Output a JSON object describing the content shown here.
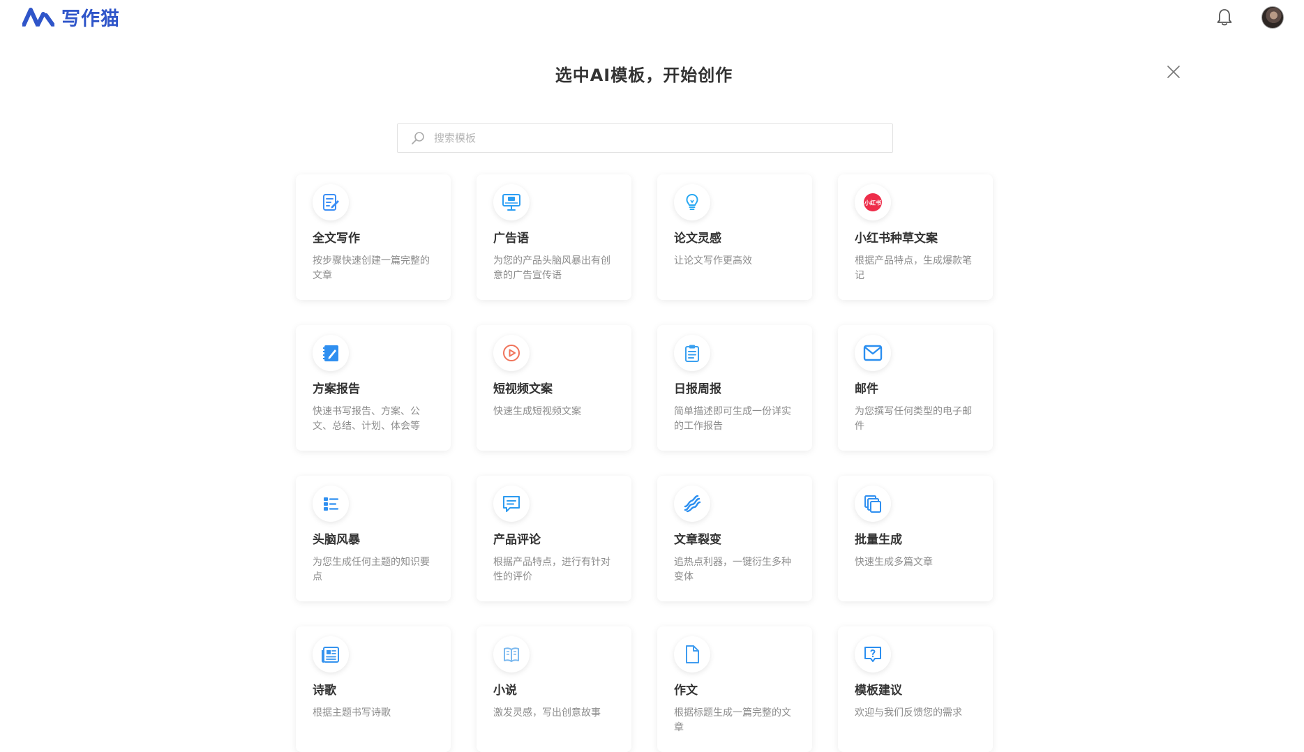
{
  "header": {
    "logo_text": "写作猫",
    "brand_color": "#2f55c9"
  },
  "modal": {
    "title": "选中AI模板，开始创作",
    "search_placeholder": "搜索模板"
  },
  "templates": [
    {
      "title": "全文写作",
      "desc": "按步骤快速创建一篇完整的文章",
      "icon": "edit-doc-icon"
    },
    {
      "title": "广告语",
      "desc": "为您的产品头脑风暴出有创意的广告宣传语",
      "icon": "ad-screen-icon"
    },
    {
      "title": "论文灵感",
      "desc": "让论文写作更高效",
      "icon": "lightbulb-icon"
    },
    {
      "title": "小红书种草文案",
      "desc": "根据产品特点，生成爆款笔记",
      "icon": "xiaohongshu-icon",
      "icon_text": "小红书"
    },
    {
      "title": "方案报告",
      "desc": "快速书写报告、方案、公文、总结、计划、体会等",
      "icon": "notebook-pen-icon"
    },
    {
      "title": "短视频文案",
      "desc": "快速生成短视频文案",
      "icon": "play-circle-icon"
    },
    {
      "title": "日报周报",
      "desc": "简单描述即可生成一份详实的工作报告",
      "icon": "clipboard-icon"
    },
    {
      "title": "邮件",
      "desc": "为您撰写任何类型的电子邮件",
      "icon": "mail-icon"
    },
    {
      "title": "头脑风暴",
      "desc": "为您生成任何主题的知识要点",
      "icon": "list-icon"
    },
    {
      "title": "产品评论",
      "desc": "根据产品特点，进行有针对性的评价",
      "icon": "comment-icon"
    },
    {
      "title": "文章裂变",
      "desc": "追热点利器，一键衍生多种变体",
      "icon": "split-arrows-icon"
    },
    {
      "title": "批量生成",
      "desc": "快速生成多篇文章",
      "icon": "stack-docs-icon"
    },
    {
      "title": "诗歌",
      "desc": "根据主题书写诗歌",
      "icon": "newspaper-icon"
    },
    {
      "title": "小说",
      "desc": "激发灵感，写出创意故事",
      "icon": "open-book-icon"
    },
    {
      "title": "作文",
      "desc": "根据标题生成一篇完整的文章",
      "icon": "document-icon"
    },
    {
      "title": "模板建议",
      "desc": "欢迎与我们反馈您的需求",
      "icon": "question-chat-icon"
    }
  ]
}
